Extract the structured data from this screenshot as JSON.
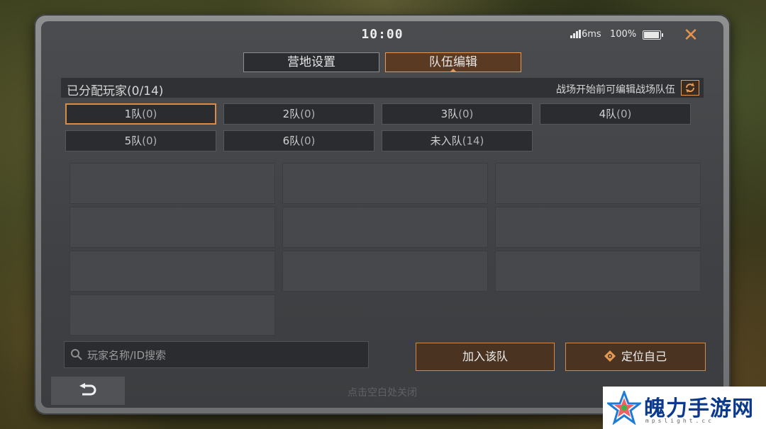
{
  "status": {
    "time": "10:00",
    "ping": "6ms",
    "battery": "100%"
  },
  "tabs": [
    {
      "label": "营地设置",
      "active": false
    },
    {
      "label": "队伍编辑",
      "active": true
    }
  ],
  "assigned": {
    "title": "已分配玩家(0/14)",
    "hint": "战场开始前可编辑战场队伍"
  },
  "teams": [
    {
      "name": "1队",
      "count": "(0)",
      "selected": true
    },
    {
      "name": "2队",
      "count": "(0)",
      "selected": false
    },
    {
      "name": "3队",
      "count": "(0)",
      "selected": false
    },
    {
      "name": "4队",
      "count": "(0)",
      "selected": false
    },
    {
      "name": "5队",
      "count": "(0)",
      "selected": false
    },
    {
      "name": "6队",
      "count": "(0)",
      "selected": false
    },
    {
      "name": "未入队",
      "count": "(14)",
      "selected": false
    }
  ],
  "search": {
    "placeholder": "玩家名称/ID搜索"
  },
  "actions": {
    "join": "加入该队",
    "locate": "定位自己"
  },
  "footer": {
    "close_hint": "点击空白处关闭"
  },
  "watermark": {
    "text": "魄力手游网",
    "sub": "mpslight.cc"
  },
  "icons": {
    "close": "close-icon",
    "refresh": "refresh-icon",
    "search": "search-icon",
    "locate": "crosshair-icon",
    "back": "back-arrow-icon",
    "signal": "signal-icon",
    "battery": "battery-icon"
  },
  "colors": {
    "accent": "#e39a55",
    "panel": "#3f4144",
    "tab_active_bg": "#5a3a22",
    "watermark": "#0b3a8c"
  }
}
